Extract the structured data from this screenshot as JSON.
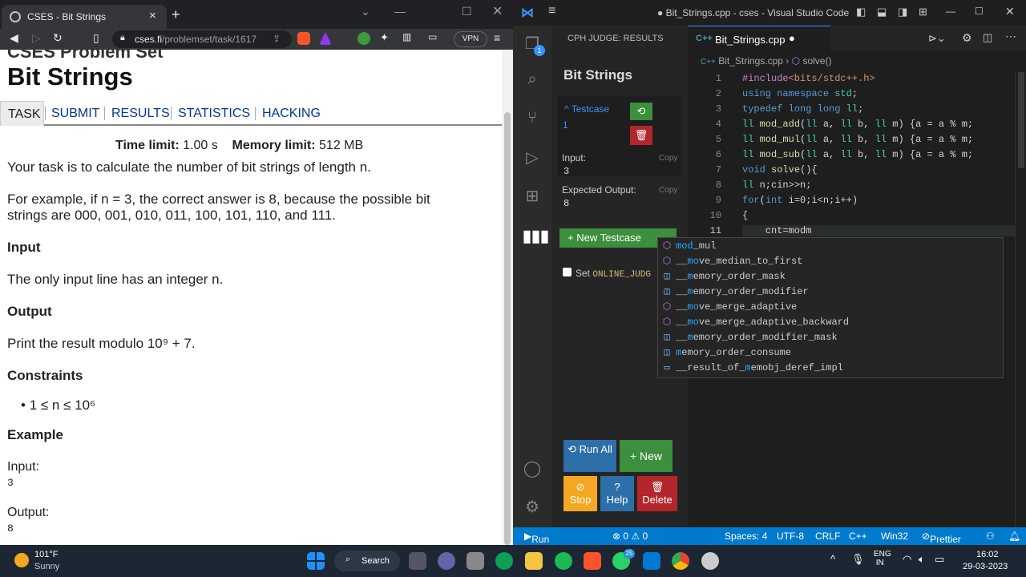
{
  "browser": {
    "tab_title": "CSES - Bit Strings",
    "url_host": "cses.fi",
    "url_path": "/problemset/task/1617",
    "vpn": "VPN"
  },
  "problem": {
    "crumb": "CSES Problem Set",
    "title": "Bit Strings",
    "tabs": [
      "TASK",
      "SUBMIT",
      "RESULTS",
      "STATISTICS",
      "HACKING"
    ],
    "time_limit_label": "Time limit:",
    "time_limit": "1.00 s",
    "memory_limit_label": "Memory limit:",
    "memory_limit": "512 MB",
    "intro": "Your task is to calculate the number of bit strings of length n.",
    "example_text_1": "For example, if n = 3, the correct answer is 8, because the possible bit",
    "example_text_2": "strings are 000, 001, 010, 011, 100, 101, 110, and 111.",
    "input_heading": "Input",
    "input_text": "The only input line has an integer n.",
    "output_heading": "Output",
    "output_text": "Print the result modulo 10⁹ + 7.",
    "constraints_heading": "Constraints",
    "constraint": "1 ≤ n ≤ 10⁶",
    "example_heading": "Example",
    "ex_input_label": "Input:",
    "ex_input": "3",
    "ex_output_label": "Output:",
    "ex_output": "8"
  },
  "vscode": {
    "window_title": "● Bit_Strings.cpp - cses - Visual Studio Code",
    "panel_title": "CPH JUDGE: RESULTS",
    "problem_name": "Bit Strings",
    "testcase_label": "Testcase",
    "testcase_num": "1",
    "input_label": "Input:",
    "input_value": "3",
    "expected_label": "Expected Output:",
    "expected_value": "8",
    "copy": "Copy",
    "new_testcase": "+ New Testcase",
    "set_label": "Set",
    "online_judge": "ONLINE_JUDG",
    "run_all": "Run All",
    "new": "New",
    "stop": "Stop",
    "help": "Help",
    "delete": "Delete",
    "file_tab": "Bit_Strings.cpp",
    "breadcrumb_file": "Bit_Strings.cpp",
    "breadcrumb_fn": "solve()",
    "badge": "1",
    "code_lines": [
      "#include<bits/stdc++.h>",
      "using namespace std;",
      "typedef long long ll;",
      "ll mod_add(ll a, ll b, ll m) {a = a % m;",
      "ll mod_mul(ll a, ll b, ll m) {a = a % m;",
      "ll mod_sub(ll a, ll b, ll m) {a = a % m;",
      "void solve(){",
      "ll n;cin>>n;",
      "for(int i=0;i<n;i++)",
      "{",
      "    cnt=modm"
    ],
    "line_numbers": [
      "1",
      "2",
      "3",
      "4",
      "5",
      "6",
      "7",
      "8",
      "9",
      "10",
      "11"
    ],
    "suggestions": [
      {
        "pre": "",
        "hl": "mod",
        "post": "_mul",
        "icon": "⬡"
      },
      {
        "pre": "__",
        "hl": "mo",
        "post": "ve_median_to_first",
        "icon": "⬡"
      },
      {
        "pre": "__",
        "hl": "m",
        "post": "emory_order_mask",
        "icon": "◫"
      },
      {
        "pre": "__",
        "hl": "m",
        "post": "emory_order_modifier",
        "icon": "◫"
      },
      {
        "pre": "__",
        "hl": "mo",
        "post": "ve_merge_adaptive",
        "icon": "⬡"
      },
      {
        "pre": "__",
        "hl": "mo",
        "post": "ve_merge_adaptive_backward",
        "icon": "⬡"
      },
      {
        "pre": "__",
        "hl": "m",
        "post": "emory_order_modifier_mask",
        "icon": "◫"
      },
      {
        "pre": "",
        "hl": "m",
        "post": "emory_order_consume",
        "icon": "◫"
      },
      {
        "pre": "__result_of_",
        "hl": "m",
        "post": "emobj_deref_impl",
        "icon": "▭"
      }
    ]
  },
  "status": {
    "run": "Run Testcases",
    "problems": "⊗ 0 ⚠ 0",
    "spaces": "Spaces: 4",
    "encoding": "UTF-8",
    "eol": "CRLF",
    "lang": "C++",
    "platform": "Win32",
    "prettier": "Prettier"
  },
  "taskbar": {
    "temp": "101°F",
    "weather": "Sunny",
    "search": "Search",
    "lang1": "ENG",
    "lang2": "IN",
    "time": "16:02",
    "date": "29-03-2023",
    "wa_badge": "25"
  }
}
